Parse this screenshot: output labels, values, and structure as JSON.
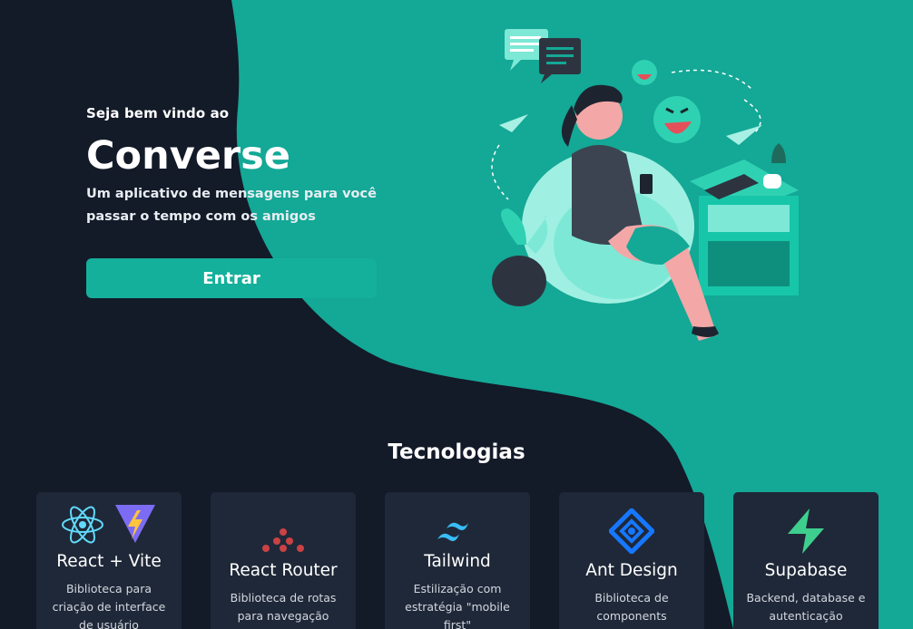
{
  "hero": {
    "welcome": "Seja bem vindo ao",
    "title": "Converse",
    "subtitle": "Um aplicativo de mensagens para você passar o tempo com os amigos",
    "button": "Entrar"
  },
  "technologies": {
    "title": "Tecnologias",
    "cards": [
      {
        "name": "React + Vite",
        "desc": "Biblioteca para criação de interface de usuário"
      },
      {
        "name": "React Router",
        "desc": "Biblioteca de rotas para navegação"
      },
      {
        "name": "Tailwind",
        "desc": "Estilização com estratégia \"mobile first\""
      },
      {
        "name": "Ant Design",
        "desc": "Biblioteca de components"
      },
      {
        "name": "Supabase",
        "desc": "Backend, database e autenticação"
      }
    ]
  },
  "colors": {
    "background": "#131a28",
    "accent": "#14a896",
    "card": "#1f2838"
  }
}
